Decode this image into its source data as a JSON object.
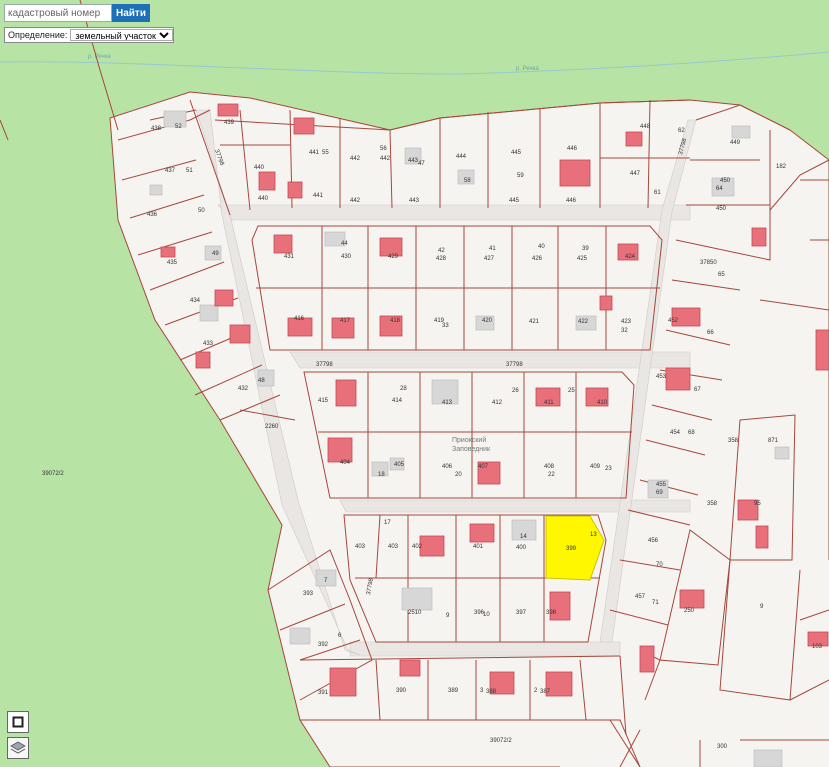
{
  "search": {
    "placeholder": "кадастровый номер",
    "button_label": "Найти"
  },
  "definition": {
    "label": "Определение:",
    "selected": "земельный участок"
  },
  "tools": [
    {
      "name": "frame-tool-icon"
    },
    {
      "name": "layers-icon"
    }
  ],
  "map": {
    "colors": {
      "forest": "#b7e3a5",
      "land": "#f6f4f1",
      "parcel_line": "#a7463a",
      "building": "#e7707a",
      "building_outline": "#c44b55",
      "structure": "#d6d6d6",
      "highlight": "#fff700"
    },
    "river_labels": [
      "р. Речка",
      "р. Речка"
    ],
    "street_labels": [
      "37798",
      "37798",
      "37798",
      "37798",
      "37798"
    ],
    "place_label": [
      "Приокский",
      "Заповедник"
    ],
    "labels": [
      "439",
      "438",
      "52",
      "437",
      "51",
      "436",
      "50",
      "435",
      "49",
      "434",
      "433",
      "432",
      "48",
      "2260",
      "39072/2",
      "441",
      "55",
      "442",
      "56",
      "442",
      "443",
      "47",
      "444",
      "58",
      "445",
      "59",
      "446",
      "447",
      "61",
      "448",
      "62",
      "440",
      "440",
      "441",
      "442",
      "443",
      "445",
      "446",
      "431",
      "44",
      "430",
      "429",
      "42",
      "428",
      "41",
      "427",
      "40",
      "426",
      "39",
      "425",
      "424",
      "416",
      "417",
      "418",
      "419",
      "33",
      "420",
      "421",
      "422",
      "423",
      "32",
      "415",
      "414",
      "28",
      "413",
      "412",
      "26",
      "411",
      "25",
      "410",
      "404",
      "18",
      "405",
      "406",
      "20",
      "407",
      "408",
      "22",
      "409",
      "23",
      "17",
      "403",
      "403",
      "402",
      "401",
      "14",
      "400",
      "399",
      "13",
      "2510",
      "9",
      "396",
      "10",
      "397",
      "398",
      "393",
      "7",
      "392",
      "6",
      "391",
      "390",
      "389",
      "3",
      "388",
      "2",
      "387",
      "39072/2",
      "182",
      "450",
      "449",
      "64",
      "450",
      "37850",
      "65",
      "452",
      "66",
      "453",
      "67",
      "454",
      "68",
      "455",
      "69",
      "456",
      "70",
      "457",
      "71",
      "250",
      "358",
      "358",
      "871",
      "95",
      "9",
      "103",
      "300"
    ]
  }
}
